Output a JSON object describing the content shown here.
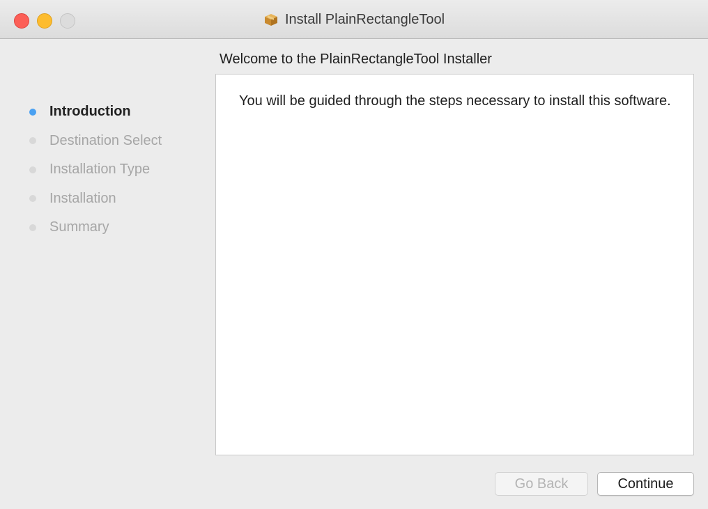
{
  "window": {
    "title": "Install PlainRectangleTool",
    "title_icon": "package-icon"
  },
  "traffic_lights": {
    "close_color": "#fc5f57",
    "minimize_color": "#fdbc2e",
    "zoom_color": "#dcdcdc"
  },
  "sidebar": {
    "active_color": "#4aa1f2",
    "steps": [
      {
        "label": "Introduction",
        "active": true
      },
      {
        "label": "Destination Select",
        "active": false
      },
      {
        "label": "Installation Type",
        "active": false
      },
      {
        "label": "Installation",
        "active": false
      },
      {
        "label": "Summary",
        "active": false
      }
    ]
  },
  "main": {
    "heading": "Welcome to the PlainRectangleTool Installer",
    "body": "You will be guided through the steps necessary to install this software."
  },
  "buttons": {
    "go_back": "Go Back",
    "continue": "Continue"
  }
}
